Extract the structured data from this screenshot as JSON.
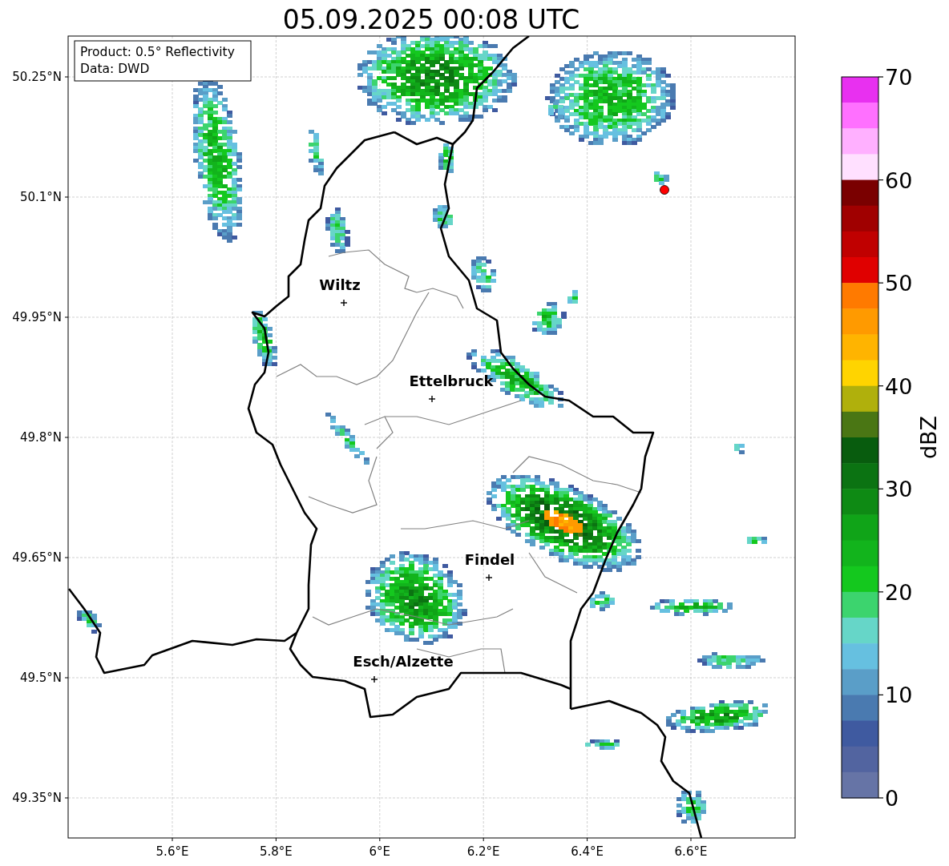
{
  "title": "05.09.2025 00:08 UTC",
  "map": {
    "info_box": [
      "Product: 0.5° Reflectivity",
      "Data: DWD"
    ],
    "yticks": [
      "50.25°N",
      "50.1°N",
      "49.95°N",
      "49.8°N",
      "49.65°N",
      "49.5°N",
      "49.35°N"
    ],
    "xticks": [
      "5.6°E",
      "5.8°E",
      "6°E",
      "6.2°E",
      "6.4°E",
      "6.6°E"
    ],
    "cities": [
      {
        "name": "Wiltz"
      },
      {
        "name": "Ettelbruck"
      },
      {
        "name": "Findel"
      },
      {
        "name": "Esch/Alzette"
      }
    ]
  },
  "colorbar": {
    "label": "dBZ",
    "ticks": [
      "70",
      "60",
      "50",
      "40",
      "30",
      "20",
      "10",
      "0"
    ],
    "bands": [
      {
        "color": "#e830f0"
      },
      {
        "color": "#ff70ff"
      },
      {
        "color": "#ffb0ff"
      },
      {
        "color": "#ffe0ff"
      },
      {
        "color": "#7a0000"
      },
      {
        "color": "#a00000"
      },
      {
        "color": "#c00000"
      },
      {
        "color": "#e00000"
      },
      {
        "color": "#ff7a00"
      },
      {
        "color": "#ff9a00"
      },
      {
        "color": "#ffb400"
      },
      {
        "color": "#ffd400"
      },
      {
        "color": "#b0b00c"
      },
      {
        "color": "#4a7614"
      },
      {
        "color": "#085c0e"
      },
      {
        "color": "#0b7312"
      },
      {
        "color": "#0e8a14"
      },
      {
        "color": "#10a418"
      },
      {
        "color": "#12b41c"
      },
      {
        "color": "#14c81e"
      },
      {
        "color": "#3cd46e"
      },
      {
        "color": "#66d6c8"
      },
      {
        "color": "#66c0e0"
      },
      {
        "color": "#5a9ec8"
      },
      {
        "color": "#4a7ab0"
      },
      {
        "color": "#3f5aa0"
      },
      {
        "color": "#5264a0"
      },
      {
        "color": "#6674a6"
      }
    ]
  }
}
